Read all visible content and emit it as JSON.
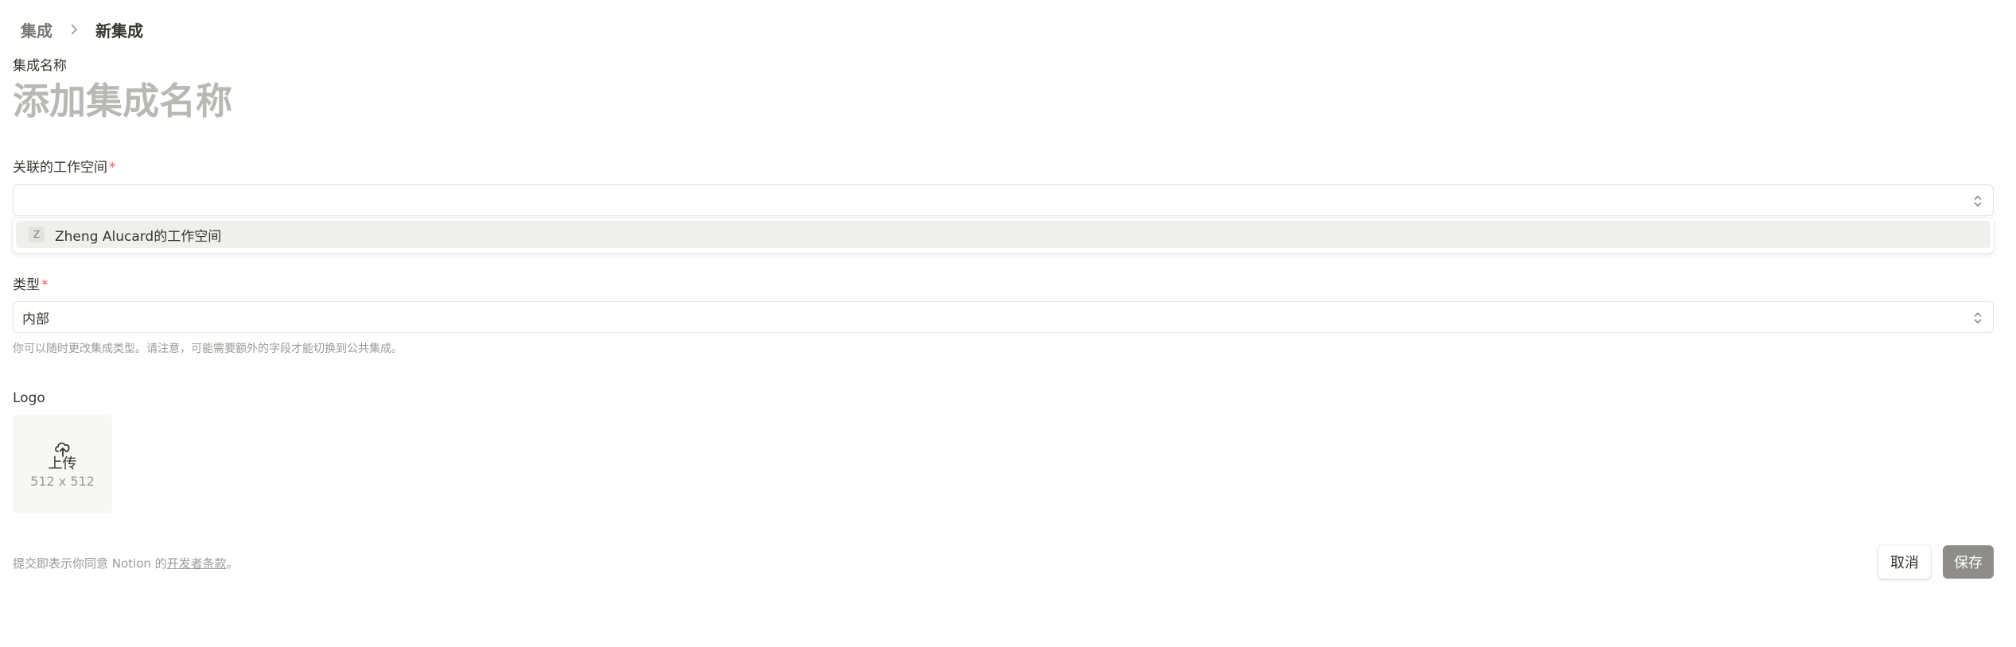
{
  "breadcrumb": {
    "parent": "集成",
    "current": "新集成"
  },
  "integration_name": {
    "label": "集成名称",
    "placeholder": "添加集成名称",
    "value": ""
  },
  "workspace": {
    "label": "关联的工作空间",
    "required_mark": "*",
    "selected_value": "",
    "options": [
      {
        "initial": "Z",
        "label": "Zheng Alucard的工作空间"
      }
    ]
  },
  "type": {
    "label": "类型",
    "required_mark": "*",
    "selected_value": "内部",
    "hint": "你可以随时更改集成类型。请注意，可能需要额外的字段才能切换到公共集成。"
  },
  "logo": {
    "label": "Logo",
    "upload_label": "上传",
    "size_hint": "512 x 512",
    "icon": "cloud-upload-icon"
  },
  "footer": {
    "terms_prefix": "提交即表示你同意 Notion 的",
    "terms_link": "开发者条款",
    "terms_suffix": "。",
    "cancel_label": "取消",
    "save_label": "保存"
  },
  "colors": {
    "required": "#eb5757",
    "save_button_bg": "#8e8d8a",
    "placeholder": "#b9b8b5",
    "muted_text": "#9b9a97"
  }
}
